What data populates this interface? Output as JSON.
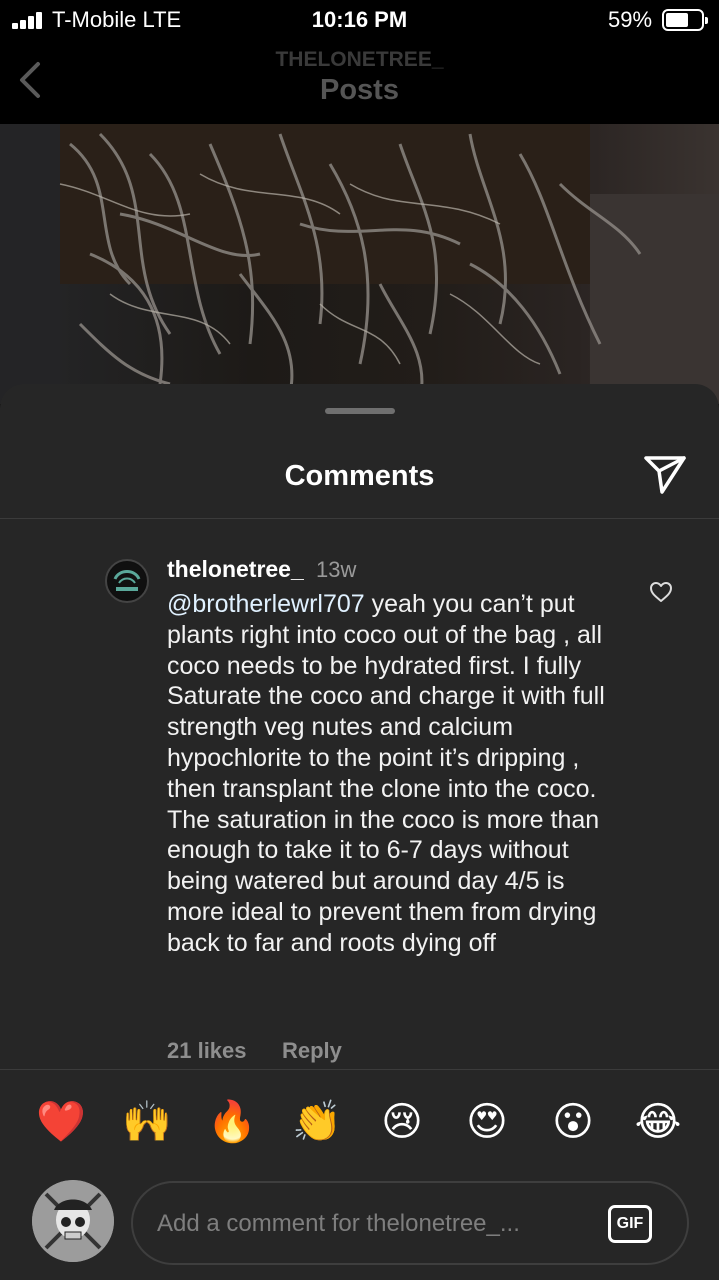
{
  "status_bar": {
    "carrier": "T-Mobile  LTE",
    "time": "10:16 PM",
    "battery": "59%"
  },
  "header": {
    "username": "THELONETREE_",
    "title": "Posts"
  },
  "sheet": {
    "title": "Comments"
  },
  "comment": {
    "username": "thelonetree_",
    "time": "13w",
    "mention": "@brotherlewrl707",
    "text": " yeah you can’t put plants right into coco out of the bag , all coco needs to be hydrated first. I fully Saturate the coco and charge it with full strength veg nutes and calcium hypochlorite to the point it’s dripping , then transplant the clone into the coco. The saturation in the coco is more than enough to take it to 6-7 days without being watered but around day 4/5 is more ideal to prevent them from drying back to far and roots dying off",
    "likes": "21 likes",
    "reply": "Reply"
  },
  "emoji_bar": [
    {
      "name": "heart",
      "glyph": "❤️"
    },
    {
      "name": "raising-hands",
      "glyph": "🙌"
    },
    {
      "name": "fire",
      "glyph": "🔥"
    },
    {
      "name": "clapping-hands",
      "glyph": "👏"
    },
    {
      "name": "crying-face",
      "glyph": "😢"
    },
    {
      "name": "heart-eyes",
      "glyph": "😍"
    },
    {
      "name": "surprised-face",
      "glyph": "😮"
    },
    {
      "name": "tears-of-joy",
      "glyph": "😂"
    }
  ],
  "composer": {
    "placeholder": "Add a comment for thelonetree_...",
    "gif_label": "GIF"
  }
}
